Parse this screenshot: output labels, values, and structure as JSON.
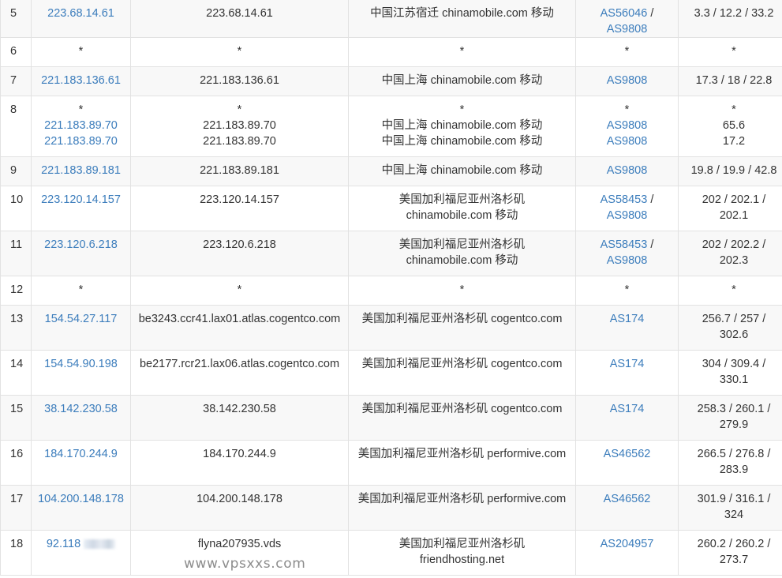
{
  "rows": [
    {
      "hop": "5",
      "ip": "223.68.14.61",
      "host": "223.68.14.61",
      "loc": [
        "中国江苏宿迁 chinamobile.com 移动"
      ],
      "asn": [
        [
          "AS56046",
          " /"
        ],
        [
          "AS9808",
          ""
        ]
      ],
      "lat": [
        "3.3 / 12.2 / 33.2"
      ],
      "h": 37
    },
    {
      "hop": "6",
      "ip": "*",
      "host": "*",
      "loc": [
        "*"
      ],
      "asn": [
        [
          "*",
          ""
        ]
      ],
      "lat": [
        "*"
      ],
      "h": 37,
      "star": true
    },
    {
      "hop": "7",
      "ip": "221.183.136.61",
      "host": "221.183.136.61",
      "loc": [
        "中国上海 chinamobile.com 移动"
      ],
      "asn": [
        [
          "AS9808",
          ""
        ]
      ],
      "lat": [
        "17.3 / 18 / 22.8"
      ],
      "h": 37
    },
    {
      "hop": "8",
      "ip": [
        "*",
        "221.183.89.70",
        "221.183.89.70"
      ],
      "host": [
        "*",
        "221.183.89.70",
        "221.183.89.70"
      ],
      "loc": [
        "*",
        "中国上海 chinamobile.com 移动",
        "中国上海 chinamobile.com 移动"
      ],
      "asn": [
        [
          "*",
          ""
        ],
        [
          "AS9808",
          ""
        ],
        [
          "AS9808",
          ""
        ]
      ],
      "lat": [
        "*",
        "65.6",
        "17.2"
      ],
      "h": 77,
      "multi": true
    },
    {
      "hop": "9",
      "ip": "221.183.89.181",
      "host": "221.183.89.181",
      "loc": [
        "中国上海 chinamobile.com 移动"
      ],
      "asn": [
        [
          "AS9808",
          ""
        ]
      ],
      "lat": [
        "19.8 / 19.9 / 42.8"
      ],
      "h": 37
    },
    {
      "hop": "10",
      "ip": "223.120.14.157",
      "host": "223.120.14.157",
      "loc": [
        "美国加利福尼亚州洛杉矶",
        "chinamobile.com 移动"
      ],
      "asn": [
        [
          "AS58453",
          " /"
        ],
        [
          "AS9808",
          ""
        ]
      ],
      "lat": [
        "202 / 202.1 /",
        "202.1"
      ],
      "h": 57
    },
    {
      "hop": "11",
      "ip": "223.120.6.218",
      "host": "223.120.6.218",
      "loc": [
        "美国加利福尼亚州洛杉矶",
        "chinamobile.com 移动"
      ],
      "asn": [
        [
          "AS58453",
          " /"
        ],
        [
          "AS9808",
          ""
        ]
      ],
      "lat": [
        "202 / 202.2 /",
        "202.3"
      ],
      "h": 57
    },
    {
      "hop": "12",
      "ip": "*",
      "host": "*",
      "loc": [
        "*"
      ],
      "asn": [
        [
          "*",
          ""
        ]
      ],
      "lat": [
        "*"
      ],
      "h": 37,
      "star": true
    },
    {
      "hop": "13",
      "ip": "154.54.27.117",
      "host": "be3243.ccr41.lax01.atlas.cogentco.com",
      "loc": [
        "美国加利福尼亚州洛杉矶 cogentco.com"
      ],
      "asn": [
        [
          "AS174",
          ""
        ]
      ],
      "lat": [
        "256.7 / 257 /",
        "302.6"
      ],
      "h": 57
    },
    {
      "hop": "14",
      "ip": "154.54.90.198",
      "host": "be2177.rcr21.lax06.atlas.cogentco.com",
      "loc": [
        "美国加利福尼亚州洛杉矶 cogentco.com"
      ],
      "asn": [
        [
          "AS174",
          ""
        ]
      ],
      "lat": [
        "304 / 309.4 /",
        "330.1"
      ],
      "h": 57
    },
    {
      "hop": "15",
      "ip": "38.142.230.58",
      "host": "38.142.230.58",
      "loc": [
        "美国加利福尼亚州洛杉矶 cogentco.com"
      ],
      "asn": [
        [
          "AS174",
          ""
        ]
      ],
      "lat": [
        "258.3 / 260.1 /",
        "279.9"
      ],
      "h": 57
    },
    {
      "hop": "16",
      "ip": "184.170.244.9",
      "host": "184.170.244.9",
      "loc": [
        "美国加利福尼亚州洛杉矶 performive.com"
      ],
      "asn": [
        [
          "AS46562",
          ""
        ]
      ],
      "lat": [
        "266.5 / 276.8 /",
        "283.9"
      ],
      "h": 57
    },
    {
      "hop": "17",
      "ip": "104.200.148.178",
      "host": "104.200.148.178",
      "loc": [
        "美国加利福尼亚州洛杉矶 performive.com"
      ],
      "asn": [
        [
          "AS46562",
          ""
        ]
      ],
      "lat": [
        "301.9 / 316.1 /",
        "324"
      ],
      "h": 57
    },
    {
      "hop": "18",
      "ip": "92.118",
      "host": "flyna207935.vds",
      "loc": [
        "美国加利福尼亚州洛杉矶",
        "friendhosting.net"
      ],
      "asn": [
        [
          "AS204957",
          ""
        ]
      ],
      "lat": [
        "260.2 / 260.2 /",
        "273.7"
      ],
      "h": 57,
      "masked": true
    }
  ],
  "watermark": "www.vpsxxs.com",
  "colors": {
    "link": "#3c7dbc",
    "odd_row": "#f8f8f8",
    "even_row": "#ffffff",
    "border": "#e2e2e2"
  }
}
